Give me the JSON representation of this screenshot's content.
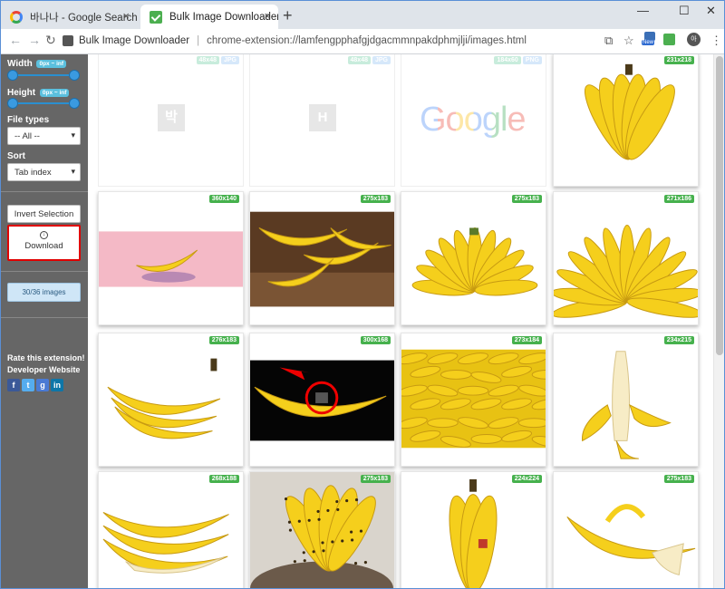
{
  "browser": {
    "tabs": [
      {
        "title": "바나나 - Google Search",
        "close": "×"
      },
      {
        "title": "Bulk Image Downloader",
        "close": "×"
      }
    ],
    "new_tab": "+",
    "window_controls": {
      "minimize": "—",
      "maximize": "☐",
      "close": "✕"
    },
    "address": {
      "extension_name": "Bulk Image Downloader",
      "separator": "|",
      "url": "chrome-extension://lamfengpphafgjdgacmmnpakdphmjlji/images.html"
    },
    "toolbar_icons": [
      "translate-icon",
      "star-icon",
      "new-extension-icon",
      "bulk-downloader-icon",
      "profile-icon",
      "menu-icon"
    ],
    "new_badge": "New",
    "profile_initial": "아"
  },
  "sidebar": {
    "width_label": "Width",
    "width_badge": "0px ~ inf",
    "height_label": "Height",
    "height_badge": "0px ~ inf",
    "width_range": [
      0,
      1
    ],
    "height_range": [
      0,
      1
    ],
    "file_types_label": "File types",
    "file_types_value": "-- All --",
    "sort_label": "Sort",
    "sort_value": "Tab index",
    "invert_label": "Invert Selection",
    "download_label": "Download",
    "count_label": "30/36 images",
    "rate_label": "Rate this extension!",
    "dev_label": "Developer Website",
    "social": [
      "f",
      "t",
      "g",
      "in"
    ]
  },
  "images": [
    {
      "size": "48x48",
      "types": [
        "JPG"
      ],
      "faded": true,
      "kind": "placeholder",
      "glyph": "박"
    },
    {
      "size": "48x48",
      "types": [
        "JPG"
      ],
      "faded": true,
      "kind": "placeholder",
      "glyph": "H"
    },
    {
      "size": "184x60",
      "types": [
        "PNG"
      ],
      "faded": true,
      "kind": "google",
      "glyph": "Google"
    },
    {
      "size": "231x218",
      "kind": "bunch"
    },
    {
      "size": "360x140",
      "kind": "pink"
    },
    {
      "size": "275x183",
      "kind": "basket"
    },
    {
      "size": "275x183",
      "kind": "hand"
    },
    {
      "size": "271x186",
      "kind": "fan"
    },
    {
      "size": "276x183",
      "kind": "bunch2"
    },
    {
      "size": "300x168",
      "kind": "bug"
    },
    {
      "size": "273x184",
      "kind": "pile"
    },
    {
      "size": "234x215",
      "kind": "peeled"
    },
    {
      "size": "268x188",
      "kind": "peeledbunch"
    },
    {
      "size": "275x183",
      "kind": "spotty"
    },
    {
      "size": "224x224",
      "kind": "standing"
    },
    {
      "size": "275x183",
      "kind": "halfpeeled"
    }
  ],
  "colors": {
    "sidebar_bg": "#666666",
    "badge_green": "#46b14d",
    "download_border": "#e00000",
    "slider_blue": "#3a9ae0"
  }
}
